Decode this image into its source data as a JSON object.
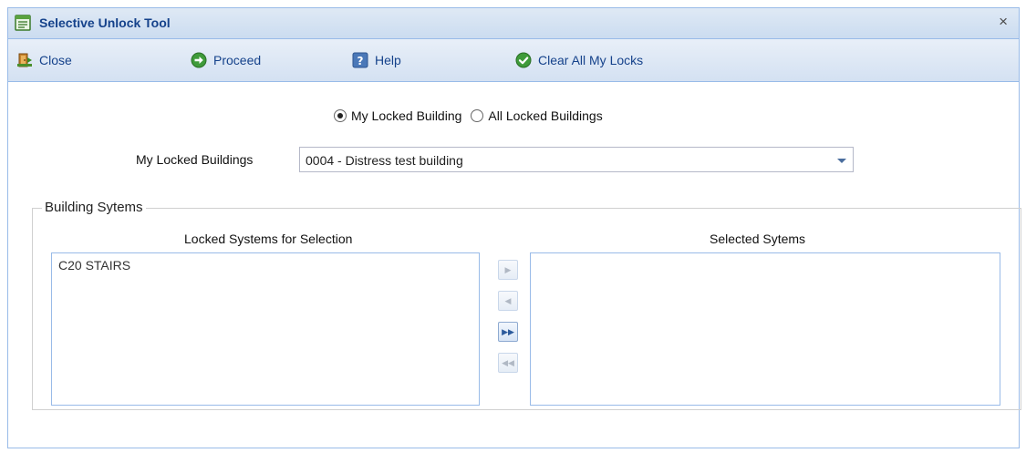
{
  "window": {
    "title": "Selective Unlock Tool",
    "close_glyph": "×"
  },
  "toolbar": {
    "close_label": "Close",
    "proceed_label": "Proceed",
    "help_label": "Help",
    "clear_label": "Clear All My Locks"
  },
  "filter": {
    "options": [
      {
        "label": "My Locked Building",
        "selected": true
      },
      {
        "label": "All Locked Buildings",
        "selected": false
      }
    ]
  },
  "building_combo": {
    "label": "My Locked Buildings",
    "value": "0004 - Distress test building"
  },
  "systems": {
    "legend": "Building Sytems",
    "available_header": "Locked Systems for Selection",
    "selected_header": "Selected Sytems",
    "available_items": [
      "C20 STAIRS"
    ],
    "selected_items": [],
    "move_buttons": [
      {
        "name": "move-right-button",
        "glyph": "▶",
        "enabled": false
      },
      {
        "name": "move-left-button",
        "glyph": "◀",
        "enabled": false
      },
      {
        "name": "move-all-right-button",
        "glyph": "▶▶",
        "enabled": true
      },
      {
        "name": "move-all-left-button",
        "glyph": "◀◀",
        "enabled": false
      }
    ]
  },
  "colors": {
    "header_text": "#15428b",
    "border": "#99bbe8",
    "accent_green": "#3c9a3c"
  },
  "icons": {
    "title": "form-icon",
    "close": "exit-door-icon",
    "proceed": "arrow-right-circle-icon",
    "help": "question-icon",
    "clear": "check-circle-icon"
  }
}
